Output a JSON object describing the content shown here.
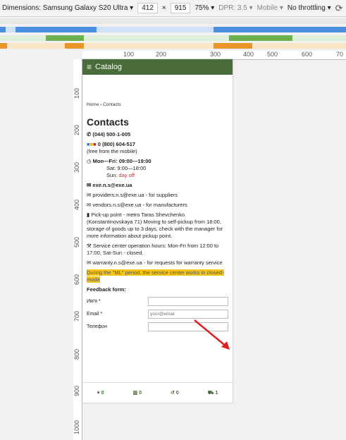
{
  "devtools": {
    "dimensions_label": "Dimensions: Samsung Galaxy S20 Ultra ▾",
    "width": "412",
    "times": "×",
    "height": "915",
    "zoom": "75% ▾",
    "dpr": "DPR: 3.5 ▾",
    "mobile": "Mobile ▾",
    "throttling": "No throttling ▾"
  },
  "ruler": [
    "100",
    "200",
    "300",
    "400",
    "500",
    "600",
    "70"
  ],
  "vruler": [
    "100",
    "200",
    "300",
    "400",
    "500",
    "600",
    "700",
    "800",
    "900",
    "1000"
  ],
  "header": {
    "burger": "≡",
    "title": "Catalog"
  },
  "breadcrumb": "Home  ›  Contacts",
  "page_title": "Contacts",
  "phone1": "(044) 500-1-005",
  "phone2": "0 (800) 604-517",
  "phone2_note": "(free from the mobile)",
  "hours": {
    "weekdays": "Mon—Fri: 09:00—19:00",
    "sat": "Sat: 9:00—18:00",
    "sun_label": "Sun:",
    "sun_value": "day off"
  },
  "email_main": "exe.n.s@exe.ua",
  "email_providers": "providers.n.s@exe.ua - for suppliers",
  "email_vendors": "vendors.n.s@exe.ua - for manufacturers",
  "pickup": "Pick-up point - metro Taras Shevchenko (Konstantinovskaya 71) Moving to self-pickup from 18:00, storage of goods up to 3 days, check with the manager for more information about pickup point.",
  "service": "Service center operation hours: Mon-Fri from 12:00 to 17:00, Sat-Sun - closed.",
  "warranty": "warranty.n.s@exe.ua - for requests for warranty service",
  "notice": "During the \"ML\" period, the service center works in closed-mode",
  "feedback_title": "Feedback form:",
  "form": {
    "name_label": "Им'я *",
    "email_label": "Email *",
    "email_placeholder": "your@email",
    "phone_label": "Телефон"
  },
  "footer": {
    "wish": "0",
    "compare": "0",
    "history": "0",
    "cart": "1"
  },
  "colors": {
    "header": "#4a6b3a",
    "highlight": "#f5c518",
    "red": "#d9221c"
  }
}
